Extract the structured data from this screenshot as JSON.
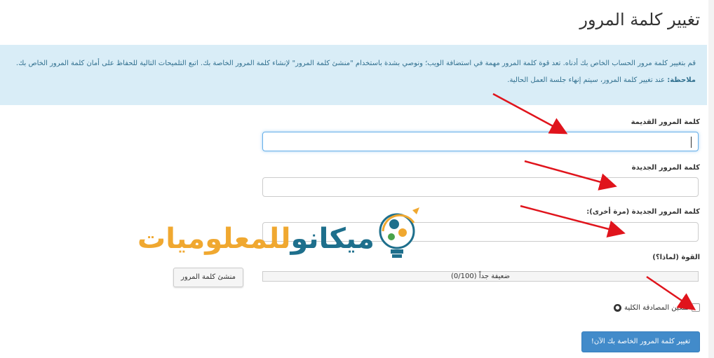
{
  "page": {
    "title": "تغيير كلمة المرور"
  },
  "info": {
    "text": "قم بتغيير كلمة مرور الحساب الخاص بك أدناه. تعد قوة كلمة المرور مهمة في استضافة الويب؛ ونوصي بشدة باستخدام \"منشئ كلمة المرور\" لإنشاء كلمة المرور الخاصة بك. اتبع التلميحات التالية للحفاظ على أمان كلمة المرور الخاص بك.",
    "note_label": "ملاحظة:",
    "note_text": "عند تغيير كلمة المرور، سيتم إنهاء جلسة العمل الحالية."
  },
  "form": {
    "old_password_label": "كلمة المرور القديمة",
    "new_password_label": "كلمة المرور الجديدة",
    "confirm_password_label": "كلمة المرور الجديدة (مرة أخرى):",
    "strength_label": "القوة (لماذا؟)",
    "strength_text": "ضعيفة جداً (0/100)",
    "strength_value": 0,
    "generator_button": "منشئ كلمة المرور",
    "checkbox_label": "تمكين المصادقة الكلية",
    "submit_button": "تغيير كلمة المرور الخاصة بك الآن!"
  },
  "watermark": {
    "text_part1": "ميكانو",
    "text_part2": "للمعلوميات"
  },
  "icons": {
    "lock": "lock-icon",
    "logo": "lightbulb-gears-icon",
    "arrow": "red-arrow-icon"
  },
  "colors": {
    "info_bg": "#d9edf7",
    "info_text": "#31708f",
    "primary": "#428bca",
    "arrow": "#e0141c",
    "watermark_orange": "#f0a830",
    "watermark_blue": "#1e6f8c"
  }
}
